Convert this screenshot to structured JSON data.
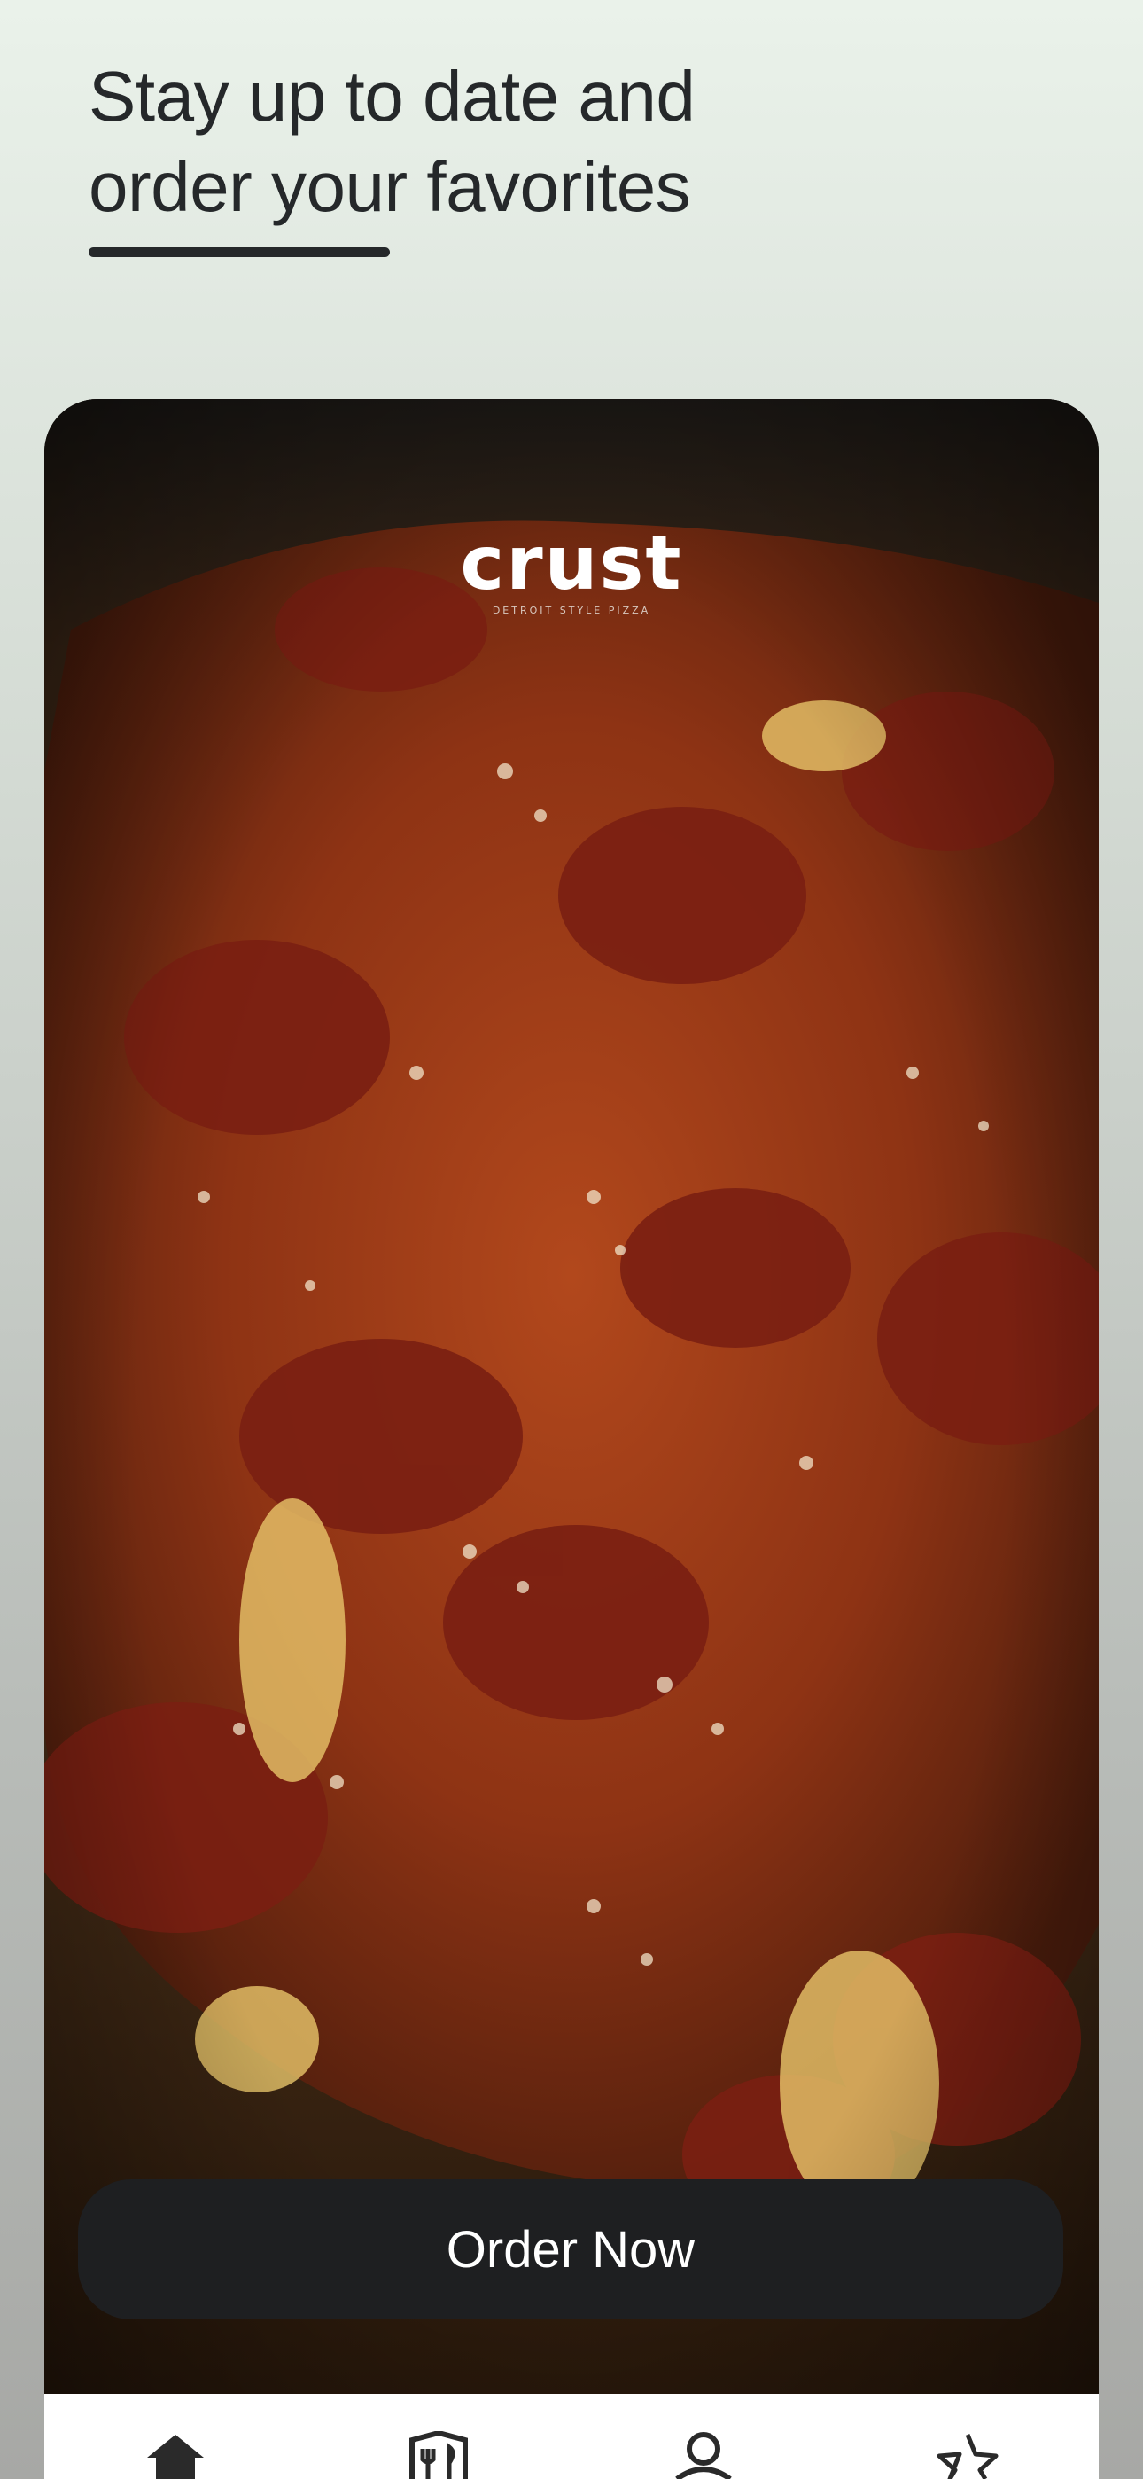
{
  "header": {
    "line1": "Stay up to date and",
    "line2": "order your favorites"
  },
  "hero": {
    "brand": "crust",
    "tagline": "DETROIT STYLE PIZZA",
    "image": "detroit-style-pepperoni-pizza-photo"
  },
  "cta": {
    "label": "Order Now"
  },
  "tabbar": {
    "items": [
      {
        "label": "Home",
        "icon": "home-icon"
      },
      {
        "label": "Menu",
        "icon": "menu-icon"
      },
      {
        "label": "Account",
        "icon": "account-icon"
      },
      {
        "label": "Rewards",
        "icon": "star-icon"
      }
    ]
  },
  "colors": {
    "text_dark": "#25282a",
    "button_bg": "#1e1f21",
    "button_text": "#ffffff"
  }
}
